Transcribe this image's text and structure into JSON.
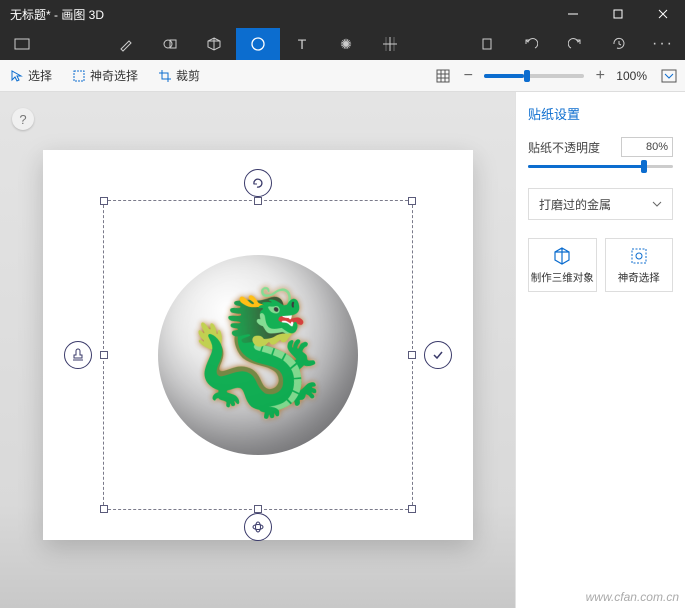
{
  "title": "无标题* - 画图 3D",
  "toolbar": {
    "select": "选择",
    "magic_select": "神奇选择",
    "crop": "裁剪",
    "zoom_pct": "100%"
  },
  "side": {
    "heading": "贴纸设置",
    "opacity_label": "贴纸不透明度",
    "opacity_value": "80%",
    "material": "打磨过的金属",
    "make3d": "制作三维对象",
    "magic": "神奇选择"
  },
  "watermark": "www.cfan.com.cn"
}
